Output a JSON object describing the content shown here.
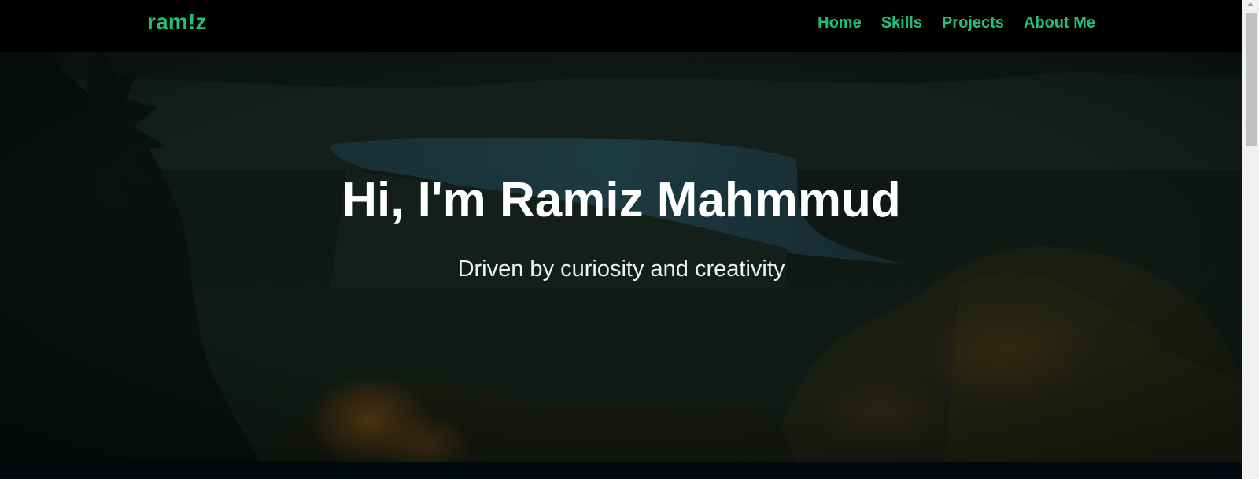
{
  "navbar": {
    "brand": "ram!z",
    "links": [
      {
        "label": "Home"
      },
      {
        "label": "Skills"
      },
      {
        "label": "Projects"
      },
      {
        "label": "About Me"
      }
    ]
  },
  "hero": {
    "title": "Hi, I'm Ramiz Mahmmud",
    "subtitle": "Driven by curiosity and creativity",
    "background": "forest-lake-landscape-image"
  },
  "colors": {
    "accent": "#20c07a",
    "navbar_bg": "#000000",
    "hero_text": "#ffffff",
    "section_bg": "#000810"
  },
  "icons": {
    "scroll_up": "triangle-up-icon"
  }
}
